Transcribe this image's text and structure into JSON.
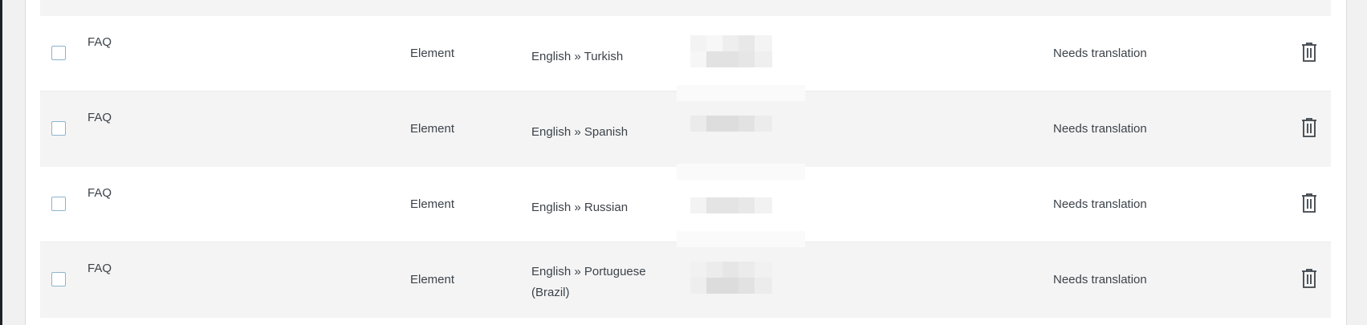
{
  "rows": [
    {
      "title": "FAQ",
      "type": "Element",
      "language": "English » Turkish",
      "status": "Needs translation"
    },
    {
      "title": "FAQ",
      "type": "Element",
      "language": "English » Spanish",
      "status": "Needs translation"
    },
    {
      "title": "FAQ",
      "type": "Element",
      "language": "English » Russian",
      "status": "Needs translation"
    },
    {
      "title": "FAQ",
      "type": "Element",
      "language": "English » Portuguese (Brazil)",
      "status": "Needs translation"
    }
  ],
  "icons": {
    "row_action": "trash-icon",
    "select": "checkbox"
  },
  "colors": {
    "row_alt_background": "#f4f4f4",
    "checkbox_border": "#8cb4cf",
    "text": "#3c434a"
  }
}
